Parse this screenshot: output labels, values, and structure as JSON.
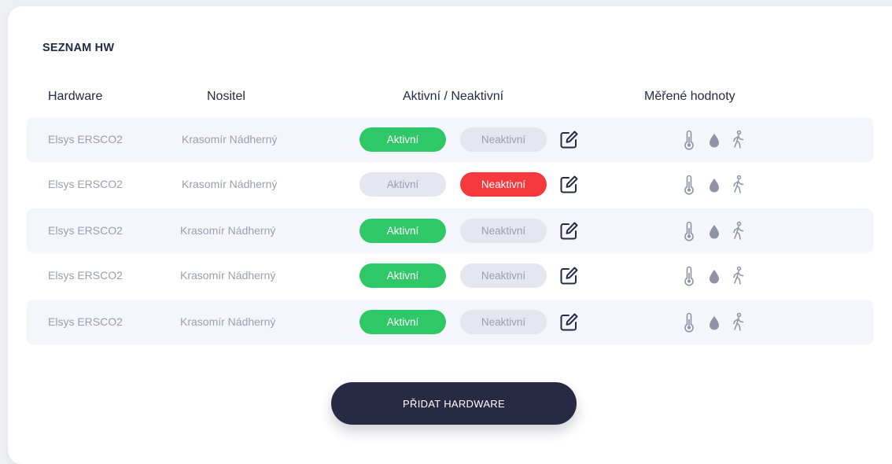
{
  "section_title": "SEZNAM HW",
  "columns": {
    "hardware": "Hardware",
    "nositel": "Nositel",
    "status": "Aktivní / Neaktivní",
    "measured": "Měřené hodnoty"
  },
  "rows": [
    {
      "hardware": "Elsys ERSCO2",
      "nositel": "Krasomír Nádherný",
      "active_label": "Aktivní",
      "inactive_label": "Neaktivní",
      "status": "active"
    },
    {
      "hardware": "Elsys ERSCO2",
      "nositel": "Krasomír Nádherný",
      "active_label": "Aktivní",
      "inactive_label": "Neaktivní",
      "status": "inactive"
    },
    {
      "hardware": "Elsys ERSCO2",
      "nositel": "Krasomír Nádherný",
      "active_label": "Aktivní",
      "inactive_label": "Neaktivní",
      "status": "active"
    },
    {
      "hardware": "Elsys ERSCO2",
      "nositel": "Krasomír Nádherný",
      "active_label": "Aktivní",
      "inactive_label": "Neaktivní",
      "status": "active"
    },
    {
      "hardware": "Elsys ERSCO2",
      "nositel": "Krasomír Nádherný",
      "active_label": "Aktivní",
      "inactive_label": "Neaktivní",
      "status": "active"
    }
  ],
  "measured_icons": [
    "thermometer-icon",
    "humidity-drop-icon",
    "motion-walk-icon"
  ],
  "add_button_label": "PŘIDAT HARDWARE",
  "colors": {
    "active": "#2fc868",
    "inactive_selected": "#f5393c",
    "pill_off": "#e5e6ef",
    "button_dark": "#272945"
  }
}
